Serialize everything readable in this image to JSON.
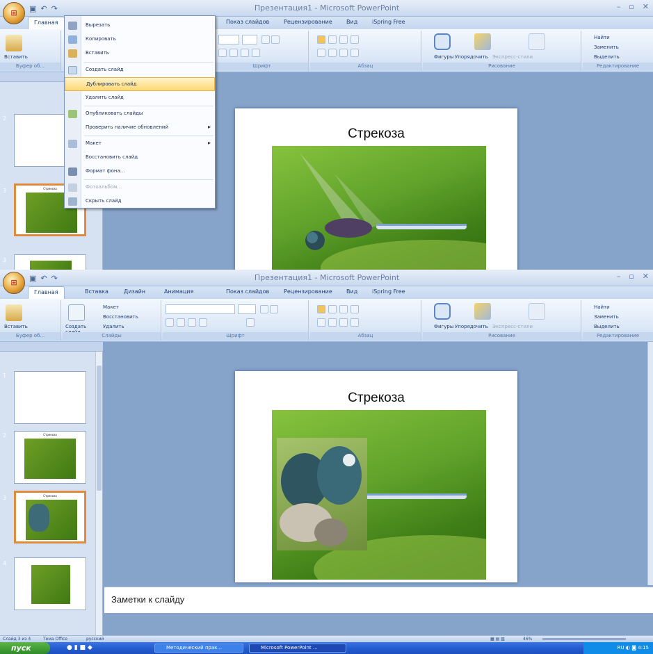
{
  "app": {
    "title": "Презентация1 - Microsoft PowerPoint"
  },
  "tabs_top": [
    "Главная",
    "Показ слайдов",
    "Рецензирование",
    "Вид",
    "iSpring Free"
  ],
  "tabs_full": [
    "Главная",
    "Вставка",
    "Дизайн",
    "Анимация",
    "Показ слайдов",
    "Рецензирование",
    "Вид",
    "iSpring Free"
  ],
  "ribbon": {
    "paste": "Вставить",
    "new_slide": "Создать слайд",
    "layout": "Макет",
    "reset": "Восстановить",
    "delete": "Удалить",
    "shapes": "Фигуры",
    "arrange": "Упорядочить",
    "quick_styles": "Экспресс-стили",
    "find": "Найти",
    "replace": "Заменить",
    "select": "Выделить",
    "groups": {
      "clipboard": "Буфер об...",
      "slides": "Слайды",
      "font": "Шрифт",
      "paragraph": "Абзац",
      "drawing": "Рисование",
      "editing": "Редактирование"
    }
  },
  "context_menu": [
    {
      "label": "Вырезать",
      "icon": "scissors-icon"
    },
    {
      "label": "Копировать",
      "icon": "copy-icon"
    },
    {
      "label": "Вставить",
      "icon": "paste-icon"
    },
    {
      "label": "Создать слайд",
      "icon": "new-slide-icon"
    },
    {
      "label": "Дублировать слайд",
      "icon": "",
      "highlighted": true
    },
    {
      "label": "Удалить слайд",
      "icon": ""
    },
    {
      "label": "Опубликовать слайды",
      "icon": "publish-icon"
    },
    {
      "label": "Проверить наличие обновлений",
      "icon": "",
      "submenu": true
    },
    {
      "label": "Макет",
      "icon": "layout-icon",
      "submenu": true
    },
    {
      "label": "Восстановить слайд",
      "icon": ""
    },
    {
      "label": "Формат фона...",
      "icon": "format-bg-icon"
    },
    {
      "label": "Фотоальбом...",
      "icon": "photo-album-icon",
      "disabled": true
    },
    {
      "label": "Скрыть слайд",
      "icon": "hide-slide-icon"
    }
  ],
  "slide": {
    "title": "Стрекоза"
  },
  "thumbs_top": [
    {
      "num": "2"
    },
    {
      "num": "3",
      "caption": "Стрекоза"
    },
    {
      "num": "3"
    }
  ],
  "thumbs": [
    {
      "num": "1"
    },
    {
      "num": "2",
      "caption": "Стрекоза"
    },
    {
      "num": "3",
      "caption": "Стрекоза"
    },
    {
      "num": "4"
    }
  ],
  "notes_placeholder": "Заметки к слайду",
  "status": {
    "slide": "Слайд 3 из 4",
    "theme": "Тема Office",
    "lang": "русский",
    "zoom": "46%"
  },
  "taskbar": {
    "start": "пуск",
    "items": [
      "Методический прак...",
      "Microsoft PowerPoint ..."
    ],
    "lang": "RU",
    "time": "4:15"
  }
}
